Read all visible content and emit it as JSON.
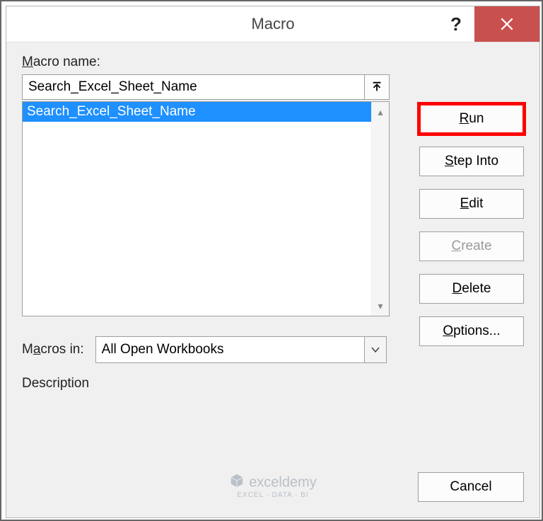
{
  "titlebar": {
    "title": "Macro"
  },
  "labels": {
    "macro_name_prefix": "M",
    "macro_name_rest": "acro name:",
    "macros_in_prefix": "M",
    "macros_in_mid": "a",
    "macros_in_rest": "cros in:",
    "description": "Description"
  },
  "macro_name_value": "Search_Excel_Sheet_Name",
  "macro_list": [
    "Search_Excel_Sheet_Name"
  ],
  "macros_in_value": "All Open Workbooks",
  "buttons": {
    "run_prefix": "R",
    "run_rest": "un",
    "stepinto_prefix": "S",
    "stepinto_rest": "tep Into",
    "edit_prefix": "E",
    "edit_rest": "dit",
    "create_prefix": "C",
    "create_rest": "reate",
    "delete_prefix": "D",
    "delete_rest": "elete",
    "options_prefix": "O",
    "options_rest": "ptions...",
    "cancel": "Cancel"
  },
  "watermark": {
    "brand": "exceldemy",
    "tagline": "EXCEL · DATA · BI"
  }
}
